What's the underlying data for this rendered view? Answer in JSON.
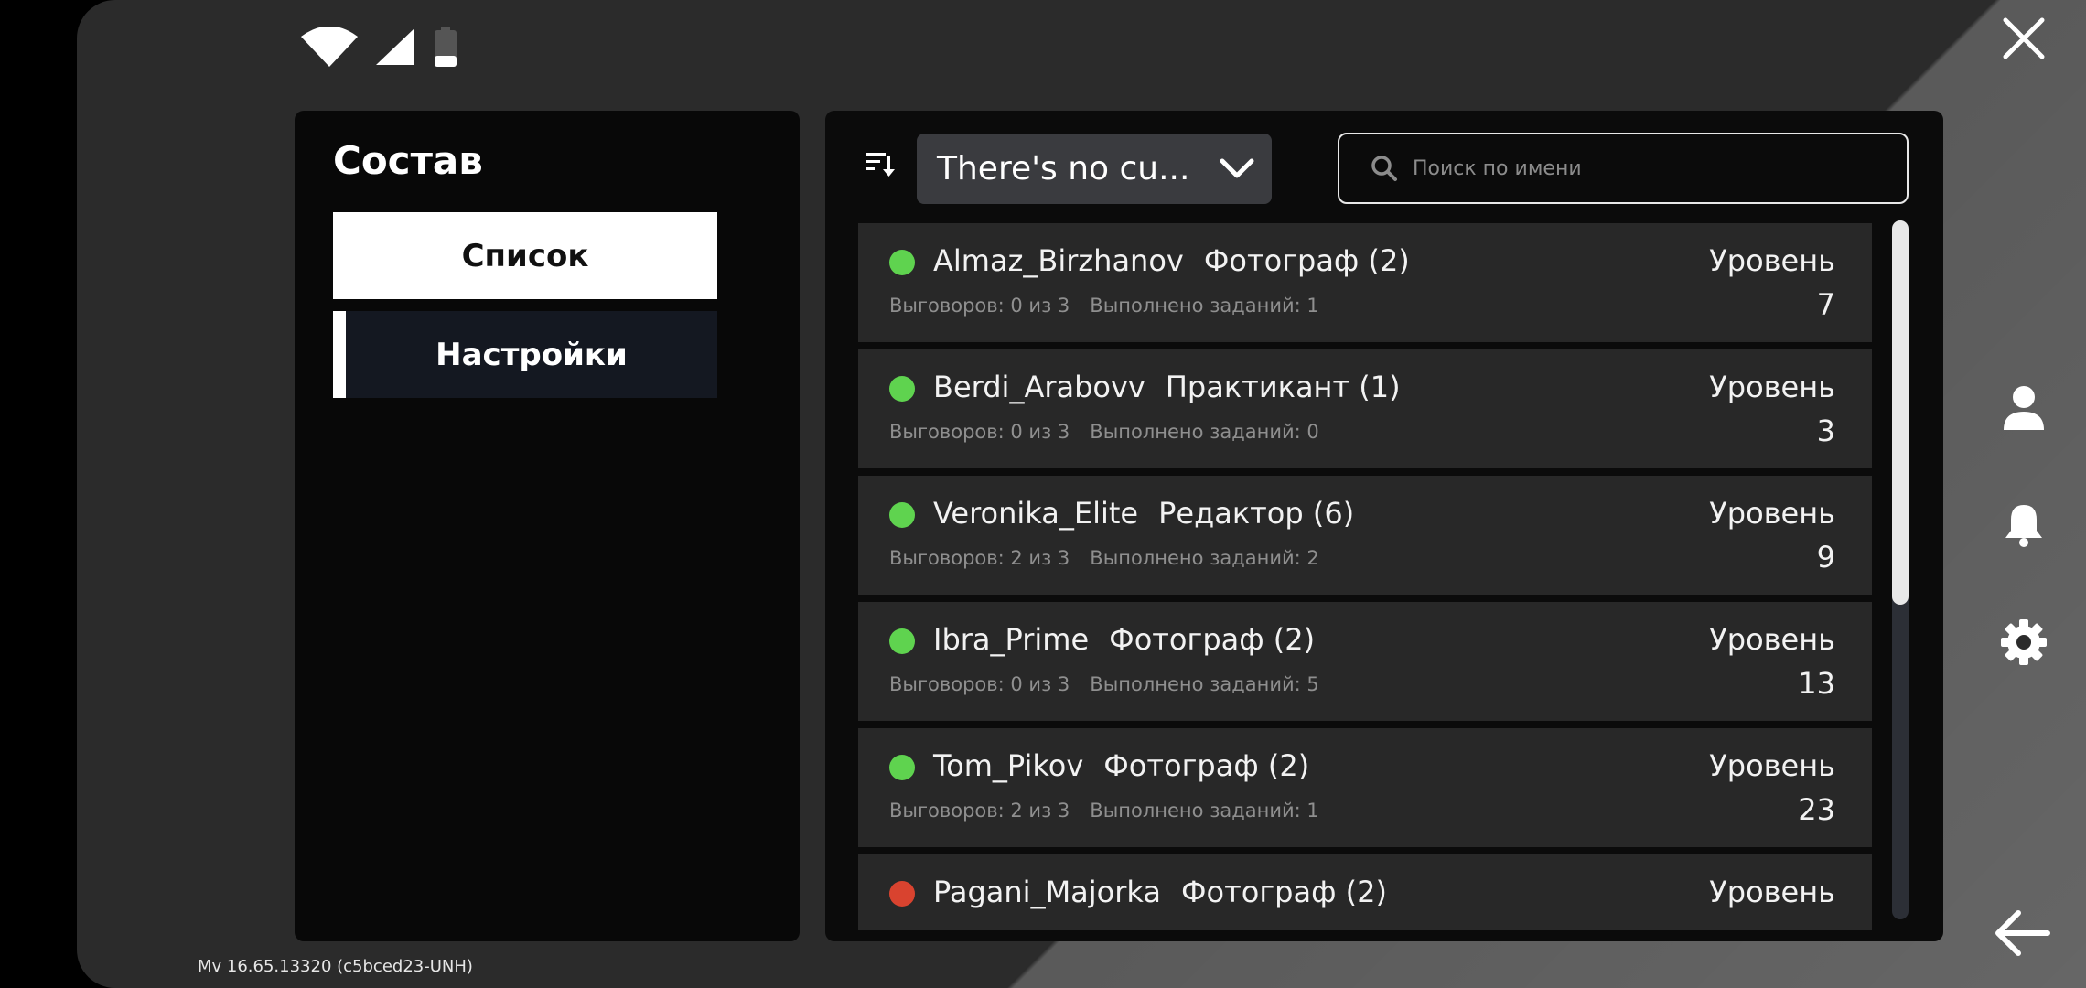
{
  "status": {
    "wifi_icon": "wifi-icon",
    "signal_icon": "signal-icon",
    "battery_icon": "battery-icon"
  },
  "left_panel": {
    "title": "Состав",
    "nav": [
      {
        "label": "Список",
        "active": true
      },
      {
        "label": "Настройки",
        "active": false
      }
    ]
  },
  "toolbar": {
    "sort_icon": "sort-icon",
    "filter_value": "There's no cu...",
    "search_placeholder": "Поиск по имени"
  },
  "members": [
    {
      "name": "Almaz_Birzhanov",
      "role": "Фотограф (2)",
      "reprimands": "Выговоров: 0 из 3",
      "tasks": "Выполнено заданий: 1",
      "level_label": "Уровень",
      "level": "7",
      "online": true
    },
    {
      "name": "Berdi_Arabovv",
      "role": "Практикант (1)",
      "reprimands": "Выговоров: 0 из 3",
      "tasks": "Выполнено заданий: 0",
      "level_label": "Уровень",
      "level": "3",
      "online": true
    },
    {
      "name": "Veronika_Elite",
      "role": "Редактор (6)",
      "reprimands": "Выговоров: 2 из 3",
      "tasks": "Выполнено заданий: 2",
      "level_label": "Уровень",
      "level": "9",
      "online": true
    },
    {
      "name": "Ibra_Prime",
      "role": "Фотограф (2)",
      "reprimands": "Выговоров: 0 из 3",
      "tasks": "Выполнено заданий: 5",
      "level_label": "Уровень",
      "level": "13",
      "online": true
    },
    {
      "name": "Tom_Pikov",
      "role": "Фотограф (2)",
      "reprimands": "Выговоров: 2 из 3",
      "tasks": "Выполнено заданий: 1",
      "level_label": "Уровень",
      "level": "23",
      "online": true
    },
    {
      "name": "Pagani_Majorka",
      "role": "Фотограф (2)",
      "reprimands": "",
      "tasks": "",
      "level_label": "Уровень",
      "level": "",
      "online": false
    }
  ],
  "colors": {
    "online": "#5fd34f",
    "offline": "#d9432f"
  },
  "side_icons": [
    "profile-icon",
    "bell-icon",
    "gear-icon"
  ],
  "version": "Mv 16.65.13320 (c5bced23-UNH)"
}
